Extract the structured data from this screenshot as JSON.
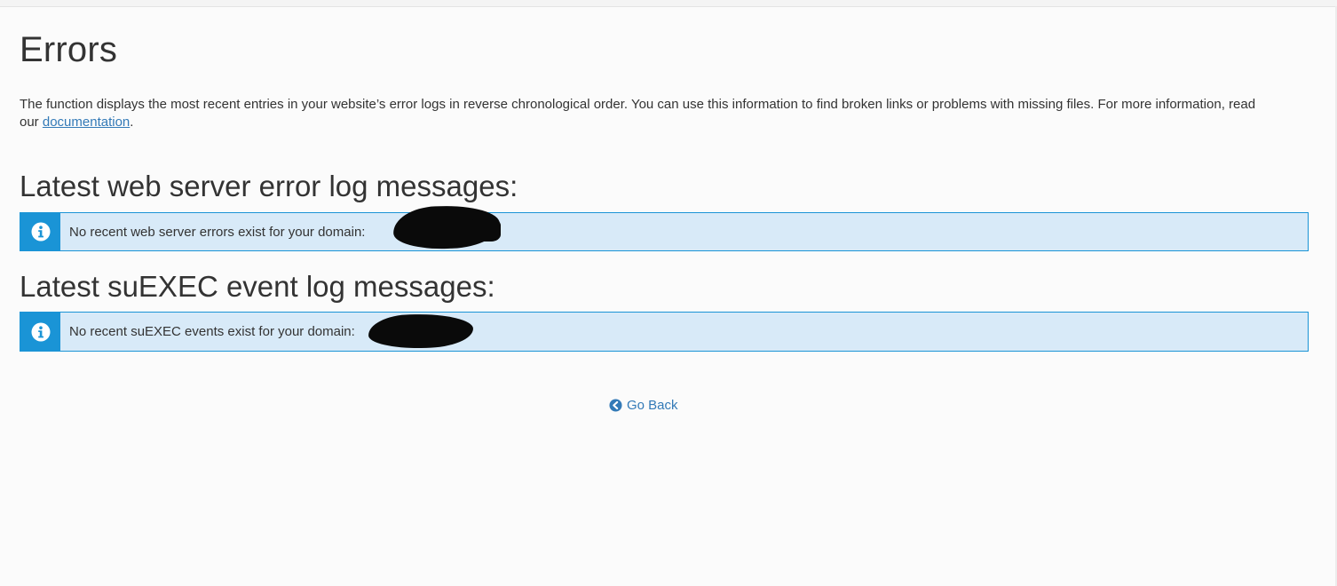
{
  "page": {
    "title": "Errors",
    "description_text": "The function displays the most recent entries in your website’s error logs in reverse chronological order. You can use this information to find broken links or problems with missing files. For more information, read our ",
    "documentation_link": "documentation",
    "description_end": "."
  },
  "web_server": {
    "heading": "Latest web server error log messages:",
    "alert_text": "No recent web server errors exist for your domain: ",
    "icon": "info-circle-icon"
  },
  "suexec": {
    "heading": "Latest suEXEC event log messages:",
    "alert_text": "No recent suEXEC events exist for your domain: ",
    "icon": "info-circle-icon"
  },
  "footer": {
    "go_back_label": "Go Back",
    "go_back_icon": "arrow-circle-left-icon"
  },
  "colors": {
    "alert_background": "#d8eaf8",
    "alert_accent": "#1a94d6",
    "link": "#337ab7",
    "redaction": "#0a0a0a"
  }
}
